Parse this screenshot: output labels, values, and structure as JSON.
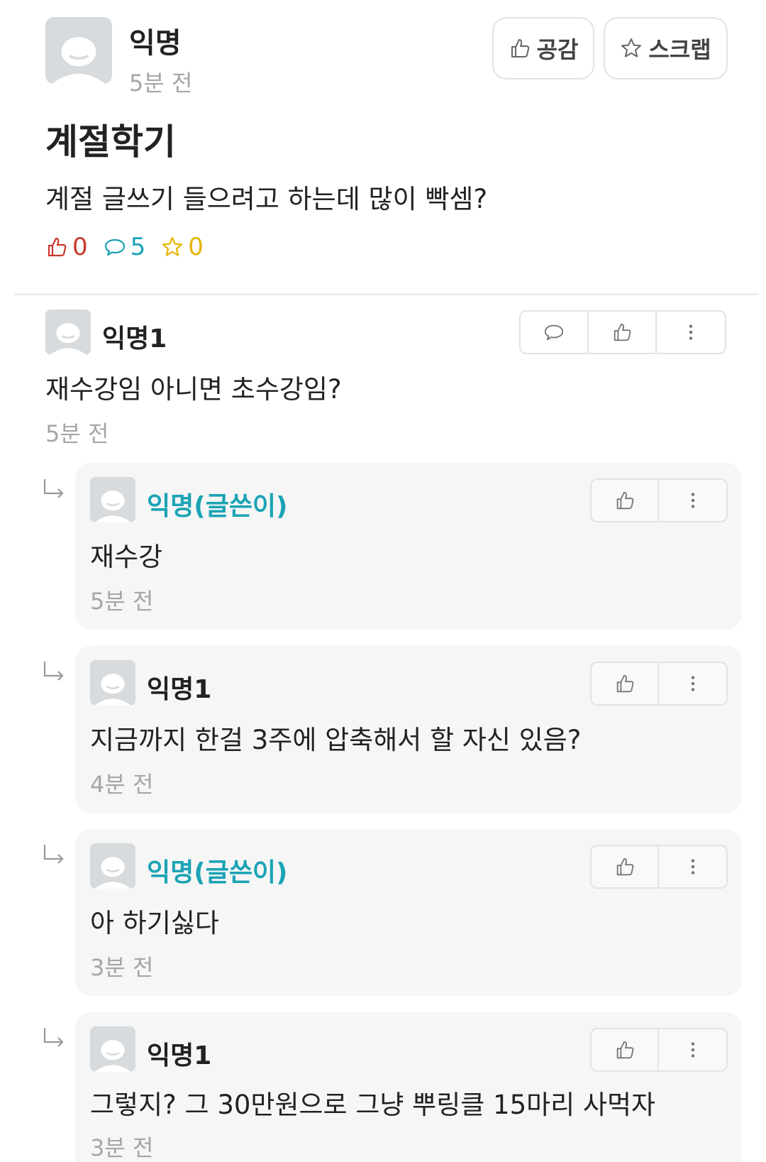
{
  "post": {
    "author": "익명",
    "time": "5분 전",
    "like_button": "공감",
    "scrap_button": "스크랩",
    "title": "계절학기",
    "body": "계절 글쓰기 들으려고 하는데 많이 빡셈?",
    "stats": {
      "likes": "0",
      "comments": "5",
      "scraps": "0"
    }
  },
  "colors": {
    "like": "#c8372d",
    "comment": "#1ba3b5",
    "scrap": "#e6b400",
    "op_name": "#1ba3b5",
    "reply_bg": "#f6f6f6"
  },
  "comments": [
    {
      "author": "익명1",
      "text": "재수강임 아니면 초수강임?",
      "time": "5분 전",
      "replies": [
        {
          "author": "익명(글쓴이)",
          "is_op": true,
          "text": "재수강",
          "time": "5분 전"
        },
        {
          "author": "익명1",
          "is_op": false,
          "text": "지금까지 한걸 3주에 압축해서 할 자신 있음?",
          "time": "4분 전"
        },
        {
          "author": "익명(글쓴이)",
          "is_op": true,
          "text": "아 하기싫다",
          "time": "3분 전"
        },
        {
          "author": "익명1",
          "is_op": false,
          "text": "그렇지? 그 30만원으로 그냥 뿌링클 15마리 사먹자",
          "time": "3분 전"
        }
      ]
    }
  ]
}
